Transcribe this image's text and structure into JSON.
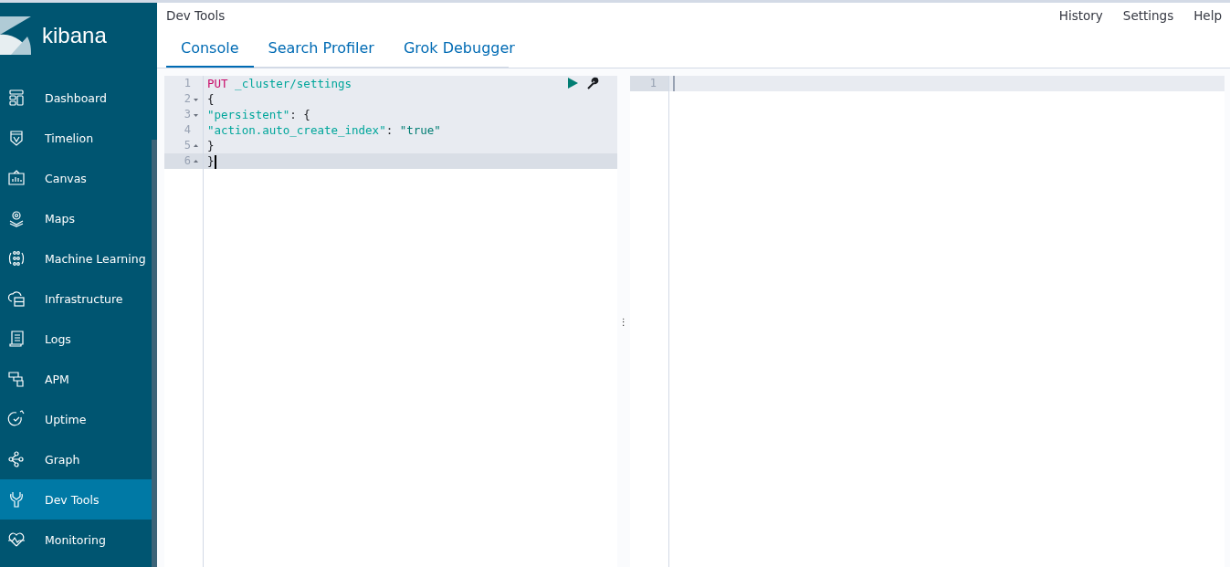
{
  "brand": {
    "name": "kibana"
  },
  "sidebar": {
    "items": [
      {
        "label": "Dashboard",
        "selected": false
      },
      {
        "label": "Timelion",
        "selected": false
      },
      {
        "label": "Canvas",
        "selected": false
      },
      {
        "label": "Maps",
        "selected": false
      },
      {
        "label": "Machine Learning",
        "selected": false
      },
      {
        "label": "Infrastructure",
        "selected": false
      },
      {
        "label": "Logs",
        "selected": false
      },
      {
        "label": "APM",
        "selected": false
      },
      {
        "label": "Uptime",
        "selected": false
      },
      {
        "label": "Graph",
        "selected": false
      },
      {
        "label": "Dev Tools",
        "selected": true
      },
      {
        "label": "Monitoring",
        "selected": false
      }
    ]
  },
  "header": {
    "title": "Dev Tools",
    "links": [
      "History",
      "Settings",
      "Help"
    ]
  },
  "tabs": [
    {
      "label": "Console",
      "selected": true
    },
    {
      "label": "Search Profiler",
      "selected": false
    },
    {
      "label": "Grok Debugger",
      "selected": false
    }
  ],
  "request_editor": {
    "lines": [
      {
        "number": "1",
        "kind": "plain",
        "active": false,
        "tokens": [
          {
            "text": "PUT",
            "kind": "method"
          },
          {
            "text": " _cluster/settings",
            "kind": "url"
          }
        ]
      },
      {
        "number": "2",
        "kind": "foldstart",
        "active": false,
        "tokens": [
          {
            "text": "{",
            "kind": "punct"
          }
        ]
      },
      {
        "number": "3",
        "kind": "foldstart",
        "active": false,
        "tokens": [
          {
            "text": "\"persistent\"",
            "kind": "key"
          },
          {
            "text": ": {",
            "kind": "punct"
          }
        ]
      },
      {
        "number": "4",
        "kind": "plain",
        "active": false,
        "tokens": [
          {
            "text": "\"action.auto_create_index\"",
            "kind": "key"
          },
          {
            "text": ": ",
            "kind": "punct"
          },
          {
            "text": "\"true\"",
            "kind": "string"
          }
        ]
      },
      {
        "number": "5",
        "kind": "foldend",
        "active": false,
        "tokens": [
          {
            "text": "}",
            "kind": "punct"
          }
        ]
      },
      {
        "number": "6",
        "kind": "foldend",
        "active": true,
        "tokens": [
          {
            "text": "}",
            "kind": "punct"
          }
        ]
      }
    ]
  },
  "resize_handle": "︙",
  "response_editor": {
    "lines": [
      {
        "number": "1",
        "active": true
      }
    ]
  }
}
